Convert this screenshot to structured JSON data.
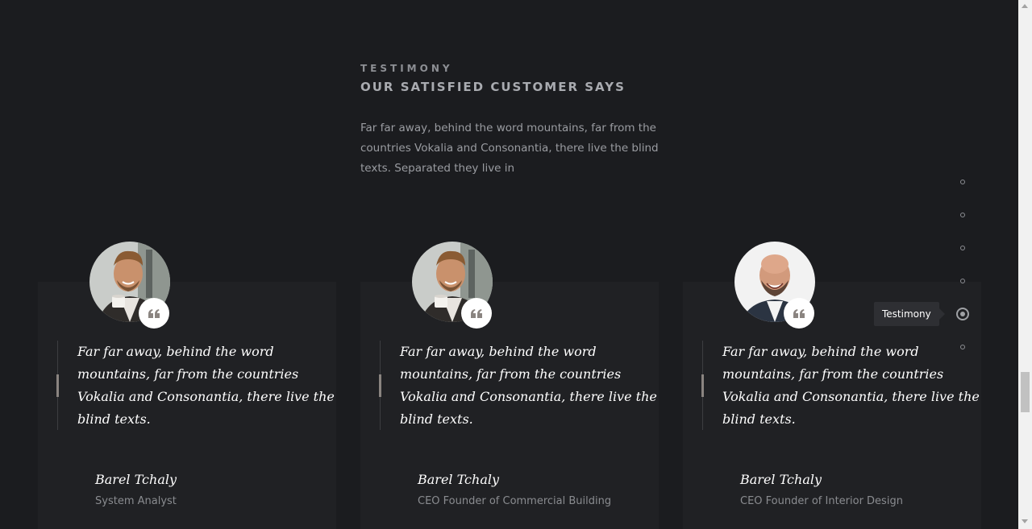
{
  "section": {
    "subheading": "TESTIMONY",
    "heading": "OUR SATISFIED CUSTOMER SAYS",
    "intro": "Far far away, behind the word mountains, far from the countries Vokalia and Consonantia, there live the blind texts. Separated they live in"
  },
  "testimonials": [
    {
      "quote": "Far far away, behind the word mountains, far from the countries Vokalia and Consonantia, there live the blind texts.",
      "name": "Barel Tchaly",
      "role": "System Analyst",
      "avatar": "man-with-coffee-cup-photo"
    },
    {
      "quote": "Far far away, behind the word mountains, far from the countries Vokalia and Consonantia, there live the blind texts.",
      "name": "Barel Tchaly",
      "role": "CEO Founder of Commercial Building",
      "avatar": "man-with-coffee-cup-photo"
    },
    {
      "quote": "Far far away, behind the word mountains, far from the countries Vokalia and Consonantia, there live the blind texts.",
      "name": "Barel Tchaly",
      "role": "CEO Founder of Interior Design",
      "avatar": "bald-laughing-man-photo"
    }
  ],
  "side_nav": {
    "tooltip": "Testimony",
    "active_index": 4,
    "dot_count": 6
  },
  "colors": {
    "background": "#1b1c1f",
    "card": "#202124",
    "accent": "#8a8480"
  }
}
